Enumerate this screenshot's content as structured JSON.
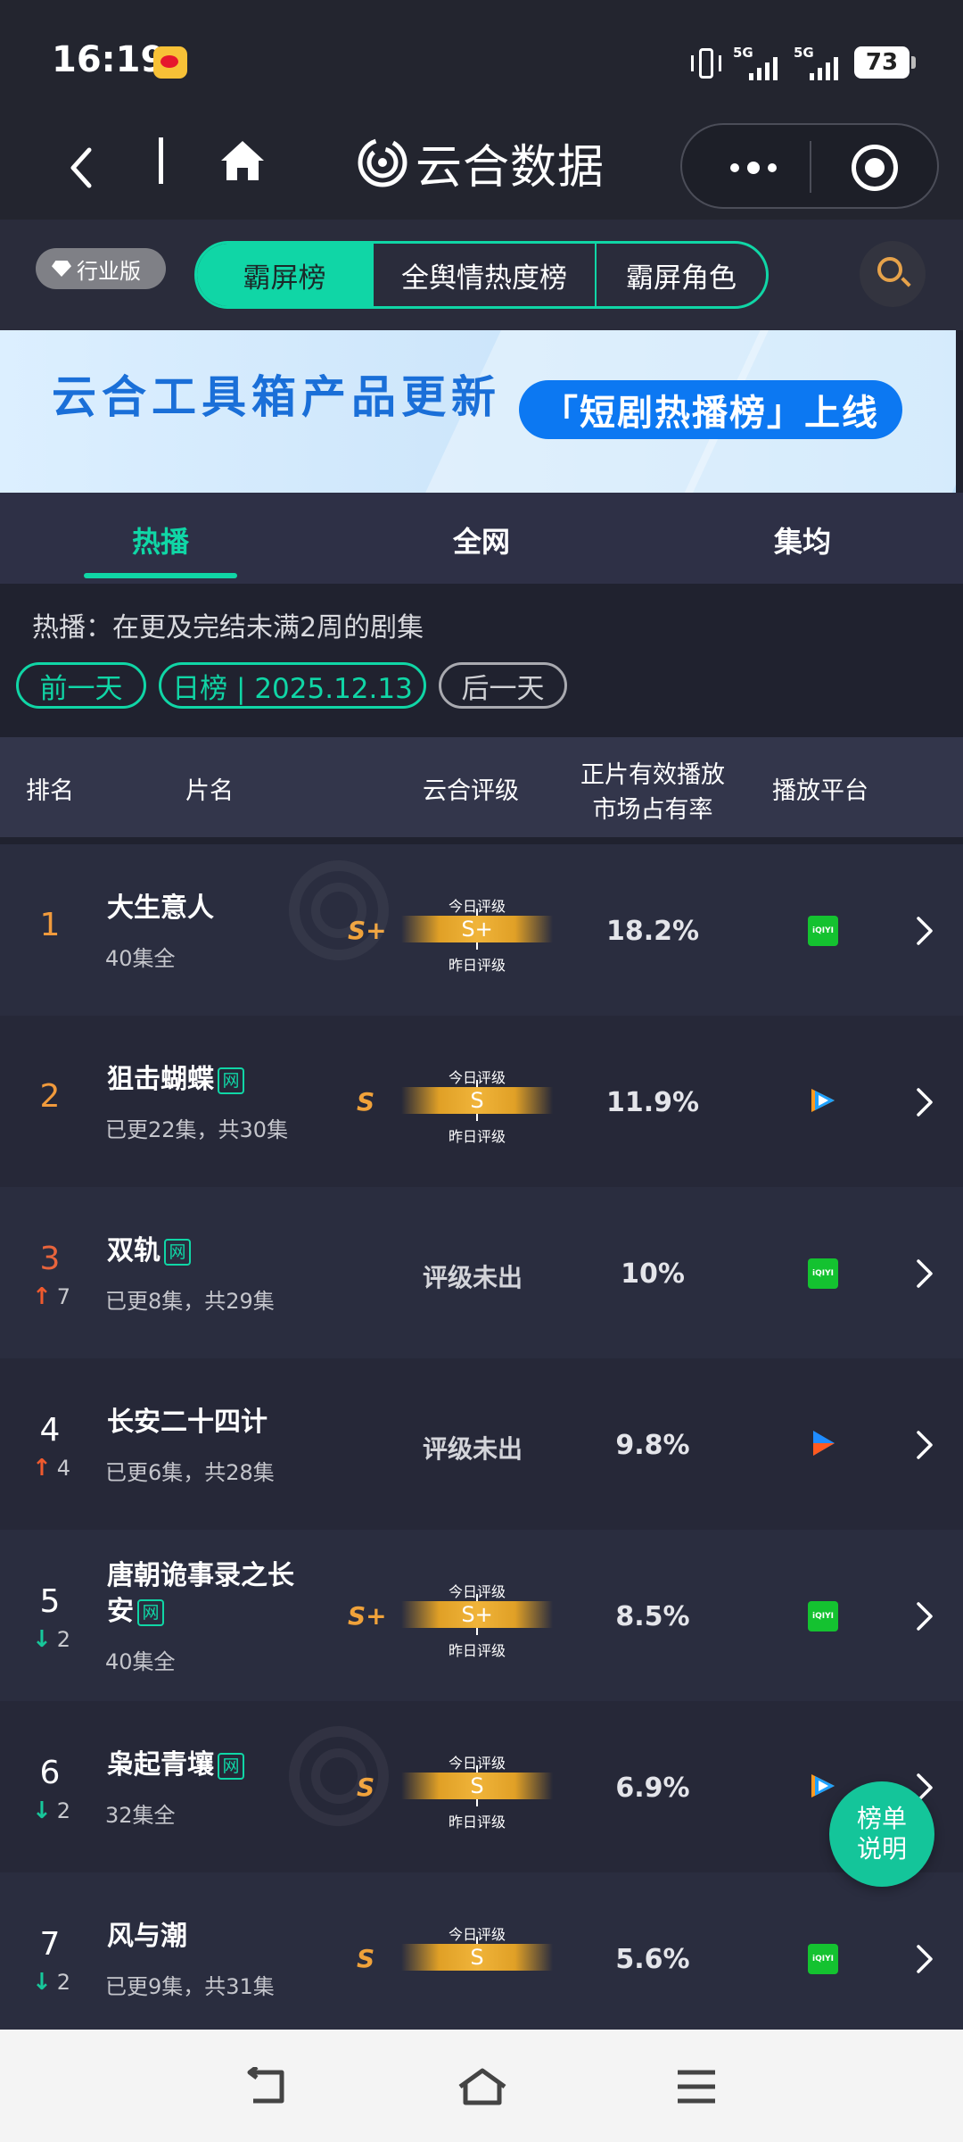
{
  "status": {
    "time": "16:19",
    "network1": "5G",
    "network2": "5G",
    "battery": "73"
  },
  "nav": {
    "brand": "云合数据"
  },
  "toprow": {
    "edition": "行业版",
    "tabs": [
      "霸屏榜",
      "全舆情热度榜",
      "霸屏角色"
    ]
  },
  "banner": {
    "title": "云合工具箱产品更新",
    "pill": "「短剧热播榜」上线"
  },
  "subtabs": [
    "热播",
    "全网",
    "集均"
  ],
  "desc": "热播：在更及完结未满2周的剧集",
  "date": {
    "prev": "前一天",
    "current": "日榜 | 2025.12.13",
    "next": "后一天"
  },
  "table": {
    "headers": {
      "rank": "排名",
      "title": "片名",
      "grade": "云合评级",
      "share_line1": "正片有效播放",
      "share_line2": "市场占有率",
      "platform": "播放平台"
    },
    "grade_today": "今日评级",
    "grade_yesterday": "昨日评级",
    "no_grade": "评级未出",
    "web_tag": "网",
    "rows": [
      {
        "rank": "1",
        "title": "大生意人",
        "episodes": "40集全",
        "grade": "S+",
        "share": "18.2%",
        "platform": "iqiyi-icon"
      },
      {
        "rank": "2",
        "title": "狙击蝴蝶",
        "episodes": "已更22集，共30集",
        "grade": "S",
        "share": "11.9%",
        "platform": "tencent-video-icon"
      },
      {
        "rank": "3",
        "trend": "7",
        "title": "双轨",
        "episodes": "已更8集，共29集",
        "grade": "",
        "share": "10%",
        "platform": "iqiyi-icon"
      },
      {
        "rank": "4",
        "trend": "4",
        "title": "长安二十四计",
        "episodes": "已更6集，共28集",
        "grade": "",
        "share": "9.8%",
        "platform": "youku-icon"
      },
      {
        "rank": "5",
        "trend": "2",
        "title_line1": "唐朝诡事录之长",
        "title_line2": "安",
        "episodes": "40集全",
        "grade": "S+",
        "share": "8.5%",
        "platform": "iqiyi-icon"
      },
      {
        "rank": "6",
        "trend": "2",
        "title": "枭起青壤",
        "episodes": "32集全",
        "grade": "S",
        "share": "6.9%",
        "platform": "tencent-video-icon"
      },
      {
        "rank": "7",
        "trend": "2",
        "title": "风与潮",
        "episodes": "已更9集，共31集",
        "grade": "S",
        "share": "5.6%",
        "platform": "iqiyi-icon"
      }
    ]
  },
  "iqiyi_label": "iQIYI",
  "float_button": {
    "line1": "榜单",
    "line2": "说明"
  },
  "colors": {
    "accent": "#10d6a6",
    "background": "#20222f",
    "grade": "#f0a23a"
  }
}
